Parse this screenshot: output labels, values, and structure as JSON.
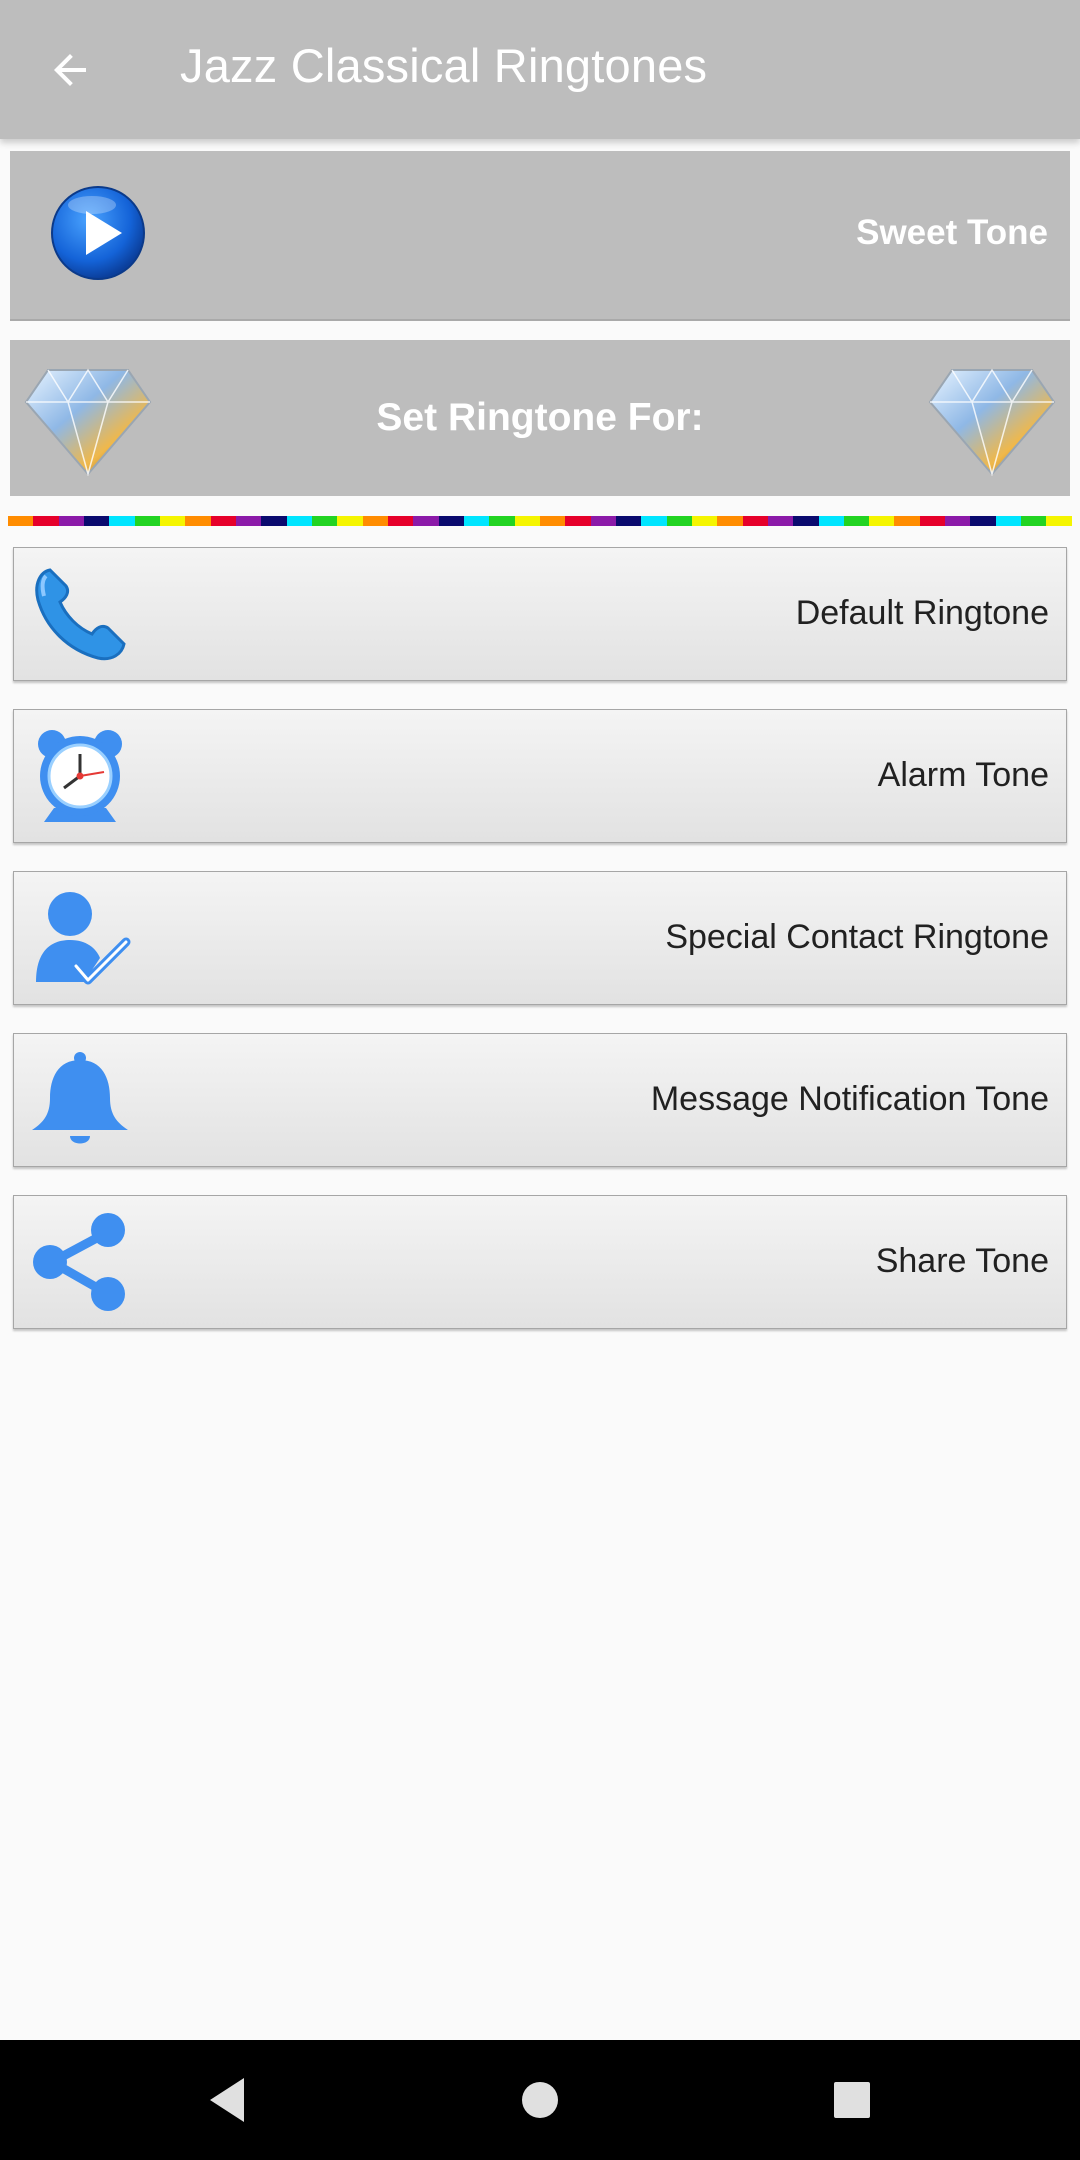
{
  "app_bar": {
    "title": "Jazz Classical Ringtones",
    "back_icon": "arrow-back-icon"
  },
  "player": {
    "tone_name": "Sweet Tone",
    "play_icon": "play-icon"
  },
  "set_for": {
    "label": "Set Ringtone For:",
    "decor_icon": "diamond-icon"
  },
  "colors": {
    "app_bar": "#bdbdbd",
    "icon_blue": "#3f8ff0",
    "rainbow": [
      "#ff8c00",
      "#e6002a",
      "#8b1aa8",
      "#0a0a6e",
      "#00e5ff",
      "#22d322",
      "#f5f500"
    ]
  },
  "options": [
    {
      "label": "Default Ringtone",
      "icon": "phone-icon"
    },
    {
      "label": "Alarm Tone",
      "icon": "alarm-clock-icon"
    },
    {
      "label": "Special Contact Ringtone",
      "icon": "contact-check-icon"
    },
    {
      "label": "Message Notification Tone",
      "icon": "bell-icon"
    },
    {
      "label": "Share Tone",
      "icon": "share-icon"
    }
  ],
  "nav": {
    "back": "nav-back-icon",
    "home": "nav-home-icon",
    "recents": "nav-recents-icon"
  }
}
